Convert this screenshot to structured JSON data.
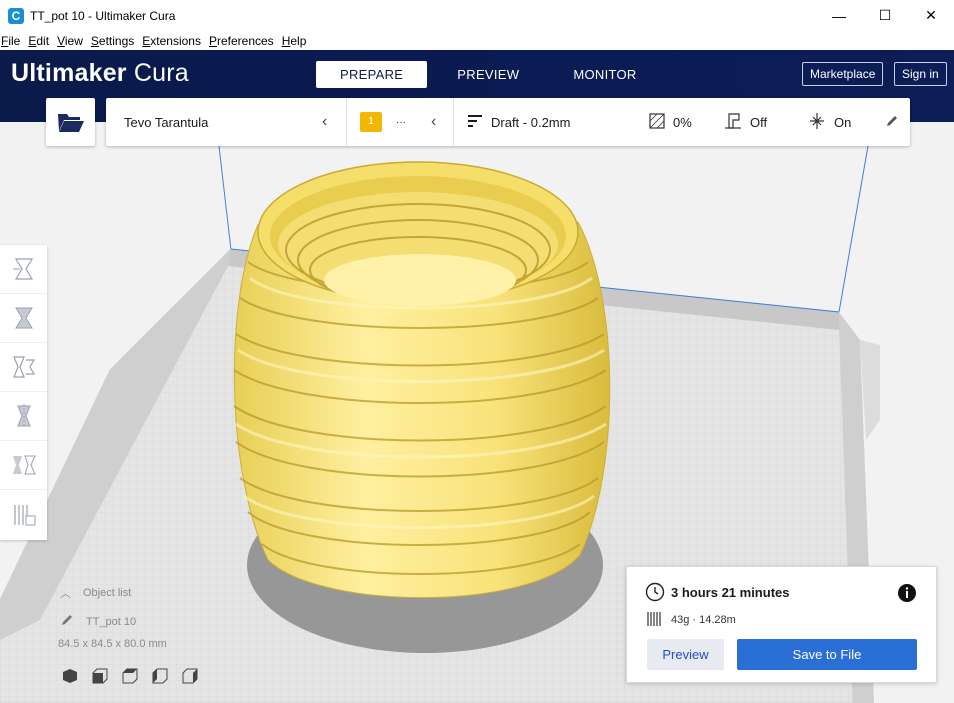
{
  "window": {
    "title": "TT_pot 10 - Ultimaker Cura",
    "app_icon": "C",
    "controls": {
      "minimize": "—",
      "maximize": "☐",
      "close": "✕"
    }
  },
  "menu": [
    {
      "key": "F",
      "rest": "ile"
    },
    {
      "key": "E",
      "rest": "dit"
    },
    {
      "key": "V",
      "rest": "iew"
    },
    {
      "key": "S",
      "rest": "ettings"
    },
    {
      "key": "E",
      "rest": "xtensions"
    },
    {
      "key": "P",
      "rest": "references"
    },
    {
      "key": "H",
      "rest": "elp"
    }
  ],
  "header": {
    "logo_bold": "Ultimaker",
    "logo_light": "Cura",
    "tabs": [
      "PREPARE",
      "PREVIEW",
      "MONITOR"
    ],
    "active_tab": "PREPARE",
    "marketplace": "Marketplace",
    "sign_in": "Sign in"
  },
  "printer_bar": {
    "printer": "Tevo Tarantula",
    "extruder_badge": "1",
    "extruder_more": "···",
    "profile": "Draft - 0.2mm",
    "infill": "0%",
    "support": "Off",
    "adhesion": "On"
  },
  "tools": [
    "move-tool",
    "scale-tool",
    "rotate-tool",
    "mirror-tool",
    "per-model-settings-tool",
    "support-blocker-tool"
  ],
  "object_list": {
    "label": "Object list",
    "object": "TT_pot 10",
    "dimensions": "84.5 x 84.5 x 80.0 mm"
  },
  "print_panel": {
    "time": "3 hours 21 minutes",
    "material": "43g · 14.28m",
    "preview_label": "Preview",
    "save_label": "Save to File"
  },
  "colors": {
    "header_bg": "#0b1c4f",
    "accent": "#2a6fd6",
    "model": "#f7e37a",
    "bed_line": "#3f7fd8"
  }
}
